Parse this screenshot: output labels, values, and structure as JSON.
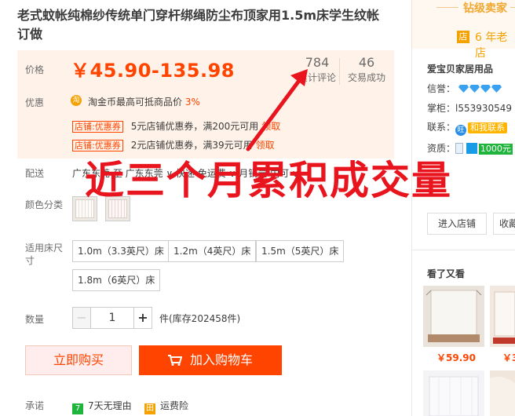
{
  "product": {
    "title": "老式蚊帐纯棉纱传统单门穿杆绑绳防尘布顶家用1.5m床学生纹帐订做"
  },
  "price_box": {
    "price_label": "价格",
    "price": "￥45.90-135.98",
    "reviews_count": "784",
    "reviews_label": "累计评论",
    "deals_count": "46",
    "deals_label": "交易成功",
    "promo_label": "优惠",
    "taojinbi_text": "淘金币最高可抵商品价",
    "taojinbi_pct": "3%",
    "coupons": [
      {
        "tag": "店铺:优惠券",
        "text": "5元店铺优惠券，满200元可用",
        "action": "领取"
      },
      {
        "tag": "店铺:优惠券",
        "text": "2元店铺优惠券，满39元可用",
        "action": "领取"
      }
    ]
  },
  "shipping": {
    "label": "配送",
    "text": "广东东莞 至 广东东莞 ∨ 快递 免运费 ∨ 月销量 内可 ∨"
  },
  "color": {
    "label": "颜色分类"
  },
  "sizes": {
    "label": "适用床尺寸",
    "options": [
      "1.0m（3.3英尺）床",
      "1.2m（4英尺）床",
      "1.5m（5英尺）床",
      "1.8m（6英尺）床"
    ]
  },
  "quantity": {
    "label": "数量",
    "minus": "−",
    "value": "1",
    "plus": "+",
    "stock": "件(库存202458件)"
  },
  "actions": {
    "buy_now": "立即购买",
    "add_to_cart": "加入购物车"
  },
  "promise": {
    "label": "承诺",
    "returns_icon": "7",
    "returns": "7天无理由",
    "insurance_icon": "田",
    "insurance": "运费险"
  },
  "overlay_text": "近三个月累积成交量",
  "seller": {
    "level": "钻级卖家",
    "years": "6 年老店",
    "years_icon": "店",
    "shop_name": "爱宝贝家居用品",
    "credit_label": "信誉：",
    "keeper_label": "掌柜：",
    "keeper": "l553930549",
    "contact_label": "联系：",
    "contact_badge": "和我联系",
    "qual_label": "资质：",
    "qual_value": "1000元",
    "enter_shop": "进入店铺",
    "favorite_shop": "收藏"
  },
  "recommend": {
    "title": "看了又看",
    "prices": [
      "￥59.90",
      "￥3"
    ]
  },
  "colors": {
    "accent": "#ff4400",
    "price_bg": "#fff2e8",
    "overlay": "#e8141e",
    "seller_gold": "#f5a100"
  }
}
